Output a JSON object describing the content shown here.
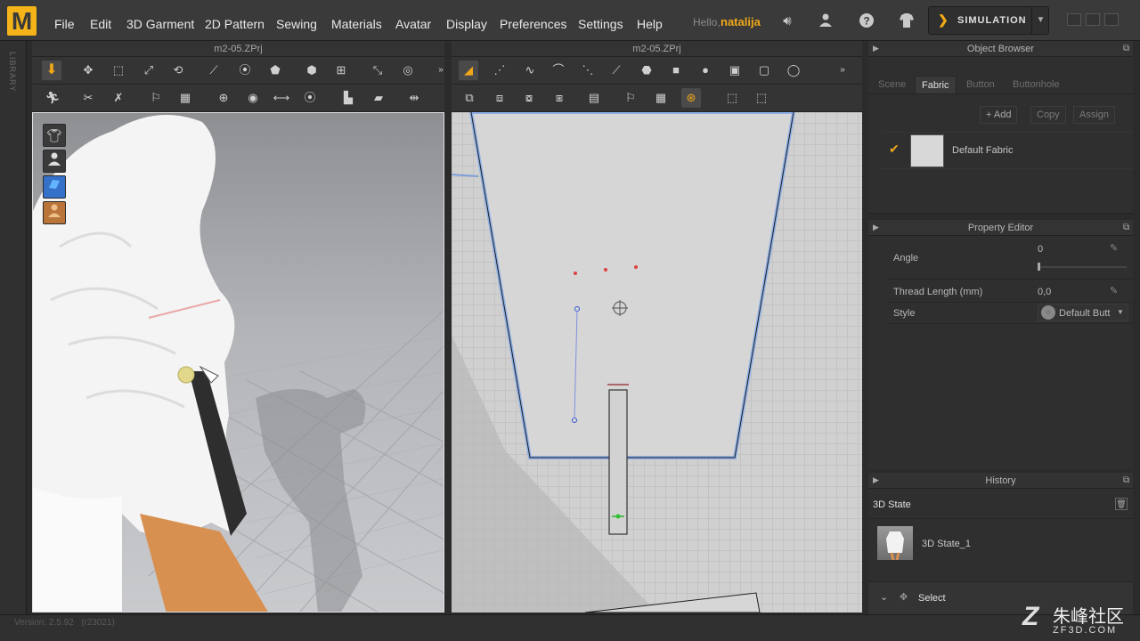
{
  "app": {
    "logo": "M",
    "username_prefix": "Hello,",
    "username": "natalija"
  },
  "menu": [
    "File",
    "Edit",
    "3D Garment",
    "2D Pattern",
    "Sewing",
    "Materials",
    "Avatar",
    "Display",
    "Preferences",
    "Settings",
    "Help"
  ],
  "simulation": {
    "label": "SIMULATION"
  },
  "library": {
    "label": "LIBRARY"
  },
  "view3d": {
    "title": "m2-05.ZPrj"
  },
  "view2d": {
    "title": "m2-05.ZPrj"
  },
  "object_browser": {
    "title": "Object Browser",
    "tabs": [
      "Scene",
      "Fabric",
      "Button",
      "Buttonhole"
    ],
    "active_tab": "Fabric",
    "buttons": {
      "add": "Add",
      "copy": "Copy",
      "assign": "Assign"
    },
    "items": [
      {
        "name": "Default Fabric",
        "checked": true
      }
    ]
  },
  "property_editor": {
    "title": "Property Editor",
    "angle": {
      "label": "Angle",
      "value": "0"
    },
    "thread_length": {
      "label": "Thread Length (mm)",
      "value": "0,0"
    },
    "style": {
      "label": "Style",
      "value": "Default Butt"
    }
  },
  "history": {
    "title": "History",
    "state_title": "3D State",
    "items": [
      {
        "name": "3D State_1"
      }
    ],
    "select_label": "Select"
  },
  "footer": {
    "version": "Version: 2.5.92",
    "build": "(r23021)"
  },
  "watermark": {
    "line1": "朱峰社区",
    "line2": "ZF3D.COM"
  }
}
